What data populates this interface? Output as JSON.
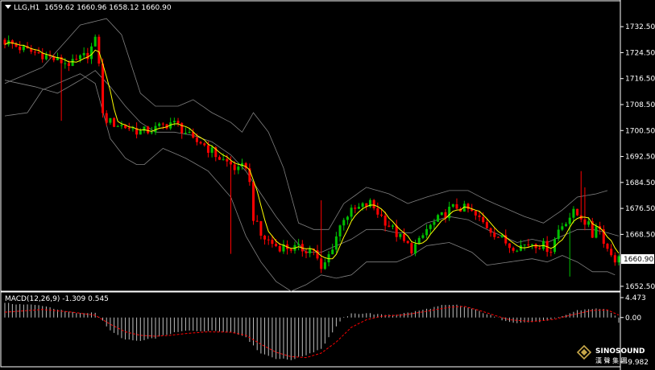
{
  "header": {
    "symbol": "LLG,H1",
    "open": "1659.62",
    "high": "1660.96",
    "low": "1658.12",
    "close": "1660.90"
  },
  "macd_header": {
    "label": "MACD(12,26,9)",
    "main": "-1.309",
    "signal": "0.545"
  },
  "logo": {
    "text": "SINOSOUND",
    "sub": "漢 聲 集 團"
  },
  "colors": {
    "background": "#000000",
    "bull": "#00c000",
    "bear": "#ff0000",
    "ma": "#ffff00",
    "bands": "#808080",
    "macd_hist": "#c0c0c0",
    "macd_signal": "#ff0000",
    "grid": "#ffffff"
  },
  "chart_data": [
    {
      "type": "candlestick",
      "symbol": "LLG",
      "timeframe": "H1",
      "y_ticks": [
        1732.5,
        1724.5,
        1716.5,
        1708.5,
        1700.5,
        1692.5,
        1684.5,
        1676.5,
        1668.5,
        1652.5
      ],
      "current_price": "1660.90",
      "ylim": [
        1651.0,
        1737.0
      ],
      "indicators": [
        "Bollinger Bands",
        "Moving Average"
      ],
      "close_anchors": [
        [
          0,
          1728
        ],
        [
          6,
          1725
        ],
        [
          10,
          1724
        ],
        [
          14,
          1722
        ],
        [
          18,
          1721
        ],
        [
          22,
          1724
        ],
        [
          24,
          1728
        ],
        [
          25,
          1722
        ],
        [
          26,
          1705
        ],
        [
          28,
          1703
        ],
        [
          31,
          1702
        ],
        [
          34,
          1701
        ],
        [
          36,
          1700
        ],
        [
          40,
          1701
        ],
        [
          44,
          1703
        ],
        [
          46,
          1702
        ],
        [
          48,
          1700
        ],
        [
          50,
          1697
        ],
        [
          52,
          1697
        ],
        [
          55,
          1694
        ],
        [
          57,
          1692
        ],
        [
          60,
          1690
        ],
        [
          62,
          1688
        ],
        [
          64,
          1690
        ],
        [
          65,
          1684
        ],
        [
          66,
          1674
        ],
        [
          68,
          1668
        ],
        [
          72,
          1665
        ],
        [
          78,
          1664
        ],
        [
          82,
          1664
        ],
        [
          84,
          1657
        ],
        [
          86,
          1662
        ],
        [
          88,
          1668
        ],
        [
          90,
          1674
        ],
        [
          93,
          1676
        ],
        [
          97,
          1678
        ],
        [
          100,
          1674
        ],
        [
          103,
          1670
        ],
        [
          106,
          1666
        ],
        [
          108,
          1664
        ],
        [
          110,
          1666
        ],
        [
          112,
          1670
        ],
        [
          115,
          1673
        ],
        [
          118,
          1676
        ],
        [
          120,
          1677
        ],
        [
          123,
          1676
        ],
        [
          126,
          1673
        ],
        [
          129,
          1670
        ],
        [
          131,
          1668
        ],
        [
          134,
          1665
        ],
        [
          137,
          1665
        ],
        [
          140,
          1666
        ],
        [
          143,
          1665
        ],
        [
          145,
          1664
        ],
        [
          147,
          1670
        ],
        [
          149,
          1673
        ],
        [
          151,
          1675
        ],
        [
          153,
          1674
        ],
        [
          155,
          1671
        ],
        [
          156,
          1668
        ],
        [
          157,
          1672
        ],
        [
          158,
          1670
        ],
        [
          160,
          1664
        ],
        [
          162,
          1661
        ],
        [
          163,
          1660.9
        ]
      ],
      "spikes": [
        [
          15,
          1703.5
        ],
        [
          60,
          1662.5
        ],
        [
          84,
          1679.0
        ],
        [
          150,
          1655.5
        ],
        [
          153,
          1688.0
        ],
        [
          154,
          1683.0
        ]
      ],
      "bollinger": {
        "upper": [
          [
            0,
            1715
          ],
          [
            10,
            1720
          ],
          [
            20,
            1733
          ],
          [
            27,
            1735
          ],
          [
            31,
            1730
          ],
          [
            36,
            1712
          ],
          [
            40,
            1708
          ],
          [
            46,
            1708
          ],
          [
            50,
            1710
          ],
          [
            55,
            1706
          ],
          [
            60,
            1703
          ],
          [
            63,
            1700
          ],
          [
            66,
            1706
          ],
          [
            70,
            1700
          ],
          [
            74,
            1689
          ],
          [
            78,
            1672
          ],
          [
            82,
            1670
          ],
          [
            86,
            1670
          ],
          [
            90,
            1678
          ],
          [
            96,
            1683
          ],
          [
            102,
            1681
          ],
          [
            107,
            1678
          ],
          [
            112,
            1680
          ],
          [
            118,
            1682
          ],
          [
            123,
            1682
          ],
          [
            128,
            1679
          ],
          [
            134,
            1676
          ],
          [
            138,
            1674
          ],
          [
            143,
            1672
          ],
          [
            148,
            1676
          ],
          [
            152,
            1680
          ],
          [
            157,
            1681
          ],
          [
            160,
            1682
          ]
        ],
        "lower": [
          [
            0,
            1705
          ],
          [
            6,
            1706
          ],
          [
            10,
            1713
          ],
          [
            16,
            1716
          ],
          [
            20,
            1718
          ],
          [
            24,
            1715
          ],
          [
            28,
            1698
          ],
          [
            32,
            1692
          ],
          [
            35,
            1690
          ],
          [
            37,
            1690
          ],
          [
            42,
            1695
          ],
          [
            48,
            1692
          ],
          [
            54,
            1688
          ],
          [
            60,
            1680
          ],
          [
            64,
            1668
          ],
          [
            68,
            1660
          ],
          [
            72,
            1654
          ],
          [
            76,
            1651
          ],
          [
            80,
            1653
          ],
          [
            84,
            1656
          ],
          [
            88,
            1655
          ],
          [
            92,
            1656
          ],
          [
            96,
            1660
          ],
          [
            100,
            1660
          ],
          [
            104,
            1660
          ],
          [
            108,
            1662
          ],
          [
            112,
            1665
          ],
          [
            118,
            1666
          ],
          [
            124,
            1663
          ],
          [
            128,
            1659
          ],
          [
            134,
            1660
          ],
          [
            140,
            1661
          ],
          [
            144,
            1660
          ],
          [
            148,
            1662
          ],
          [
            152,
            1660
          ],
          [
            156,
            1657
          ],
          [
            160,
            1657
          ],
          [
            162,
            1656
          ]
        ],
        "middle": [
          [
            0,
            1716
          ],
          [
            8,
            1714
          ],
          [
            14,
            1712
          ],
          [
            20,
            1716
          ],
          [
            24,
            1719
          ],
          [
            28,
            1714
          ],
          [
            32,
            1708
          ],
          [
            36,
            1703
          ],
          [
            40,
            1700
          ],
          [
            45,
            1700
          ],
          [
            50,
            1699
          ],
          [
            55,
            1697
          ],
          [
            60,
            1693
          ],
          [
            64,
            1688
          ],
          [
            68,
            1681
          ],
          [
            72,
            1674
          ],
          [
            76,
            1668
          ],
          [
            80,
            1663
          ],
          [
            84,
            1663
          ],
          [
            88,
            1665
          ],
          [
            92,
            1667
          ],
          [
            96,
            1670
          ],
          [
            100,
            1670
          ],
          [
            104,
            1669
          ],
          [
            108,
            1669
          ],
          [
            112,
            1672
          ],
          [
            118,
            1674
          ],
          [
            123,
            1673
          ],
          [
            128,
            1670
          ],
          [
            132,
            1668
          ],
          [
            136,
            1666
          ],
          [
            140,
            1667
          ],
          [
            144,
            1666
          ],
          [
            148,
            1668
          ],
          [
            152,
            1670
          ],
          [
            156,
            1670
          ],
          [
            160,
            1669
          ],
          [
            163,
            1668
          ]
        ]
      }
    },
    {
      "type": "bar",
      "title": "MACD(12,26,9)",
      "y_ticks": [
        "4.473",
        "0.00",
        "-9.982"
      ],
      "ylim": [
        -9.982,
        4.473
      ],
      "main_value": -1.309,
      "signal_value": 0.545,
      "hist_anchors": [
        [
          0,
          3.2
        ],
        [
          10,
          2.7
        ],
        [
          16,
          1.4
        ],
        [
          20,
          0.9
        ],
        [
          24,
          1.2
        ],
        [
          26,
          -0.8
        ],
        [
          28,
          -3.0
        ],
        [
          32,
          -5.0
        ],
        [
          36,
          -5.3
        ],
        [
          40,
          -4.6
        ],
        [
          44,
          -3.6
        ],
        [
          48,
          -3.0
        ],
        [
          52,
          -3.0
        ],
        [
          56,
          -3.0
        ],
        [
          60,
          -3.3
        ],
        [
          64,
          -4.3
        ],
        [
          66,
          -6.4
        ],
        [
          68,
          -8.0
        ],
        [
          72,
          -9.2
        ],
        [
          76,
          -9.5
        ],
        [
          80,
          -8.4
        ],
        [
          84,
          -7.0
        ],
        [
          86,
          -4.5
        ],
        [
          88,
          -2.0
        ],
        [
          90,
          0.0
        ],
        [
          92,
          0.8
        ],
        [
          96,
          1.0
        ],
        [
          100,
          0.6
        ],
        [
          104,
          0.7
        ],
        [
          108,
          1.2
        ],
        [
          112,
          1.9
        ],
        [
          116,
          2.7
        ],
        [
          120,
          2.8
        ],
        [
          124,
          2.0
        ],
        [
          128,
          0.8
        ],
        [
          132,
          -0.5
        ],
        [
          136,
          -1.2
        ],
        [
          140,
          -1.0
        ],
        [
          144,
          -0.8
        ],
        [
          148,
          0.3
        ],
        [
          152,
          1.6
        ],
        [
          156,
          2.0
        ],
        [
          160,
          1.8
        ],
        [
          162,
          0.4
        ],
        [
          163,
          -1.309
        ]
      ],
      "signal_anchors": [
        [
          0,
          1.2
        ],
        [
          10,
          1.8
        ],
        [
          18,
          1.2
        ],
        [
          24,
          0.5
        ],
        [
          28,
          -1.5
        ],
        [
          32,
          -3.2
        ],
        [
          36,
          -4.0
        ],
        [
          40,
          -4.2
        ],
        [
          44,
          -4.0
        ],
        [
          48,
          -3.6
        ],
        [
          54,
          -3.2
        ],
        [
          60,
          -3.3
        ],
        [
          64,
          -4.0
        ],
        [
          68,
          -6.0
        ],
        [
          72,
          -7.8
        ],
        [
          76,
          -8.8
        ],
        [
          80,
          -9.0
        ],
        [
          84,
          -8.0
        ],
        [
          88,
          -5.5
        ],
        [
          92,
          -2.2
        ],
        [
          96,
          -0.5
        ],
        [
          100,
          0.3
        ],
        [
          106,
          0.6
        ],
        [
          112,
          1.4
        ],
        [
          118,
          2.3
        ],
        [
          122,
          2.5
        ],
        [
          126,
          1.6
        ],
        [
          130,
          0.5
        ],
        [
          134,
          -0.5
        ],
        [
          140,
          -0.9
        ],
        [
          146,
          -0.4
        ],
        [
          150,
          0.5
        ],
        [
          156,
          1.6
        ],
        [
          160,
          1.7
        ],
        [
          163,
          0.545
        ]
      ]
    }
  ]
}
